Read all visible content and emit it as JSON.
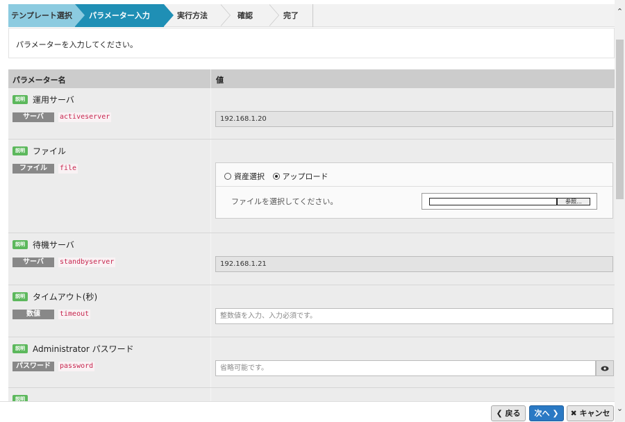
{
  "wizard": {
    "steps": [
      {
        "label": "テンプレート選択",
        "state": "done"
      },
      {
        "label": "パラメーター入力",
        "state": "active"
      },
      {
        "label": "実行方法",
        "state": "pending"
      },
      {
        "label": "確認",
        "state": "pending"
      },
      {
        "label": "完了",
        "state": "pending"
      }
    ]
  },
  "instruction": "パラメーターを入力してください。",
  "table": {
    "col_name": "パラメーター名",
    "col_value": "値"
  },
  "desc_badge": "説明",
  "params": [
    {
      "title": "運用サーバ",
      "type": "サーバ",
      "key": "activeserver",
      "value": "192.168.1.20"
    },
    {
      "title": "ファイル",
      "type": "ファイル",
      "key": "file",
      "radio_asset": "資産選択",
      "radio_upload": "アップロード",
      "selected": "アップロード",
      "file_msg": "ファイルを選択してください。",
      "browse_label": "参照..."
    },
    {
      "title": "待機サーバ",
      "type": "サーバ",
      "key": "standbyserver",
      "value": "192.168.1.21"
    },
    {
      "title": "タイムアウト(秒)",
      "type": "数値",
      "key": "timeout",
      "placeholder": "整数値を入力、入力必須です。"
    },
    {
      "title": "Administrator パスワード",
      "type": "パスワード",
      "key": "password",
      "placeholder": "省略可能です。",
      "toggle_icon": "eye-icon"
    }
  ],
  "footer": {
    "back_label": "戻る",
    "next_label": "次へ",
    "cancel_label": "キャンセル"
  },
  "colors": {
    "step_done": "#8ccbe0",
    "step_active": "#1f8fb5",
    "desc_badge": "#5cb85c",
    "type_badge": "#888888",
    "next_button": "#2a79c4"
  }
}
